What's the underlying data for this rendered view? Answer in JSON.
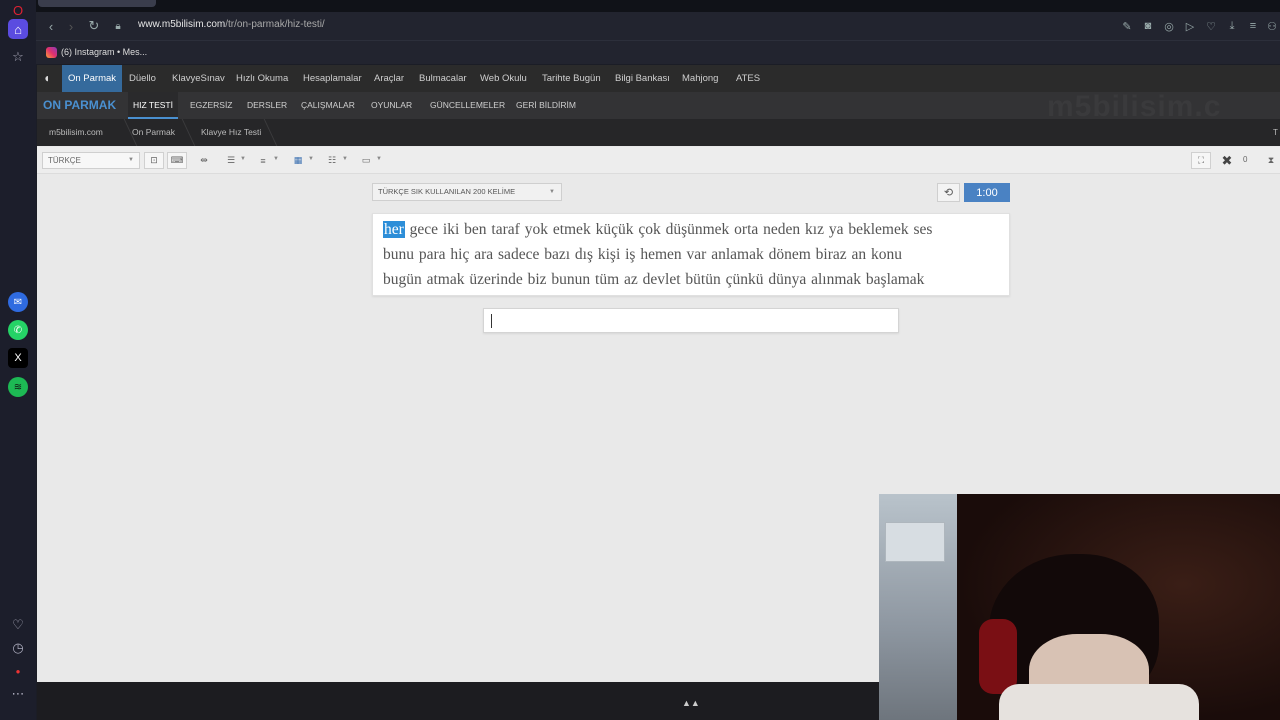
{
  "browser": {
    "url_host": "www.m5bilisim.com",
    "url_path": "/tr/on-parmak/hiz-testi/",
    "bookmark_label": "(6) Instagram • Mes..."
  },
  "site": {
    "nav1": [
      "On Parmak",
      "Düello",
      "KlavyeSınav",
      "Hızlı Okuma",
      "Hesaplamalar",
      "Araçlar",
      "Bulmacalar",
      "Web Okulu",
      "Tarihte Bugün",
      "Bilgi Bankası",
      "Mahjong",
      "ATES"
    ],
    "brand": "ON PARMAK",
    "watermark": "m5bilisim.c",
    "nav2": [
      "HIZ TESTİ",
      "EGZERSİZ",
      "DERSLER",
      "ÇALIŞMALAR",
      "OYUNLAR",
      "GÜNCELLEMELER",
      "GERİ BİLDİRİM"
    ],
    "breadcrumb": [
      "m5bilisim.com",
      "On Parmak",
      "Klavye Hız Testi"
    ],
    "breadcrumb_right": "T",
    "toolbar": {
      "language": "TÜRKÇE",
      "error_count": "0"
    }
  },
  "test": {
    "wordlist": "TÜRKÇE SIK KULLANILAN 200 KELİME",
    "timer": "1:00",
    "current_word": "her",
    "line1_rest": " gece iki ben taraf yok etmek küçük çok düşünmek orta neden kız ya beklemek ses",
    "line2": "bunu para hiç ara sadece bazı dış kişi iş hemen var anlamak dönem biraz an konu",
    "line3": "bugün atmak üzerinde biz bunun tüm az devlet bütün çünkü dünya alınmak başlamak",
    "input_value": ""
  },
  "colors": {
    "accent": "#4a82c3",
    "highlight": "#2d8ed8",
    "nav_active": "#356a9c"
  }
}
